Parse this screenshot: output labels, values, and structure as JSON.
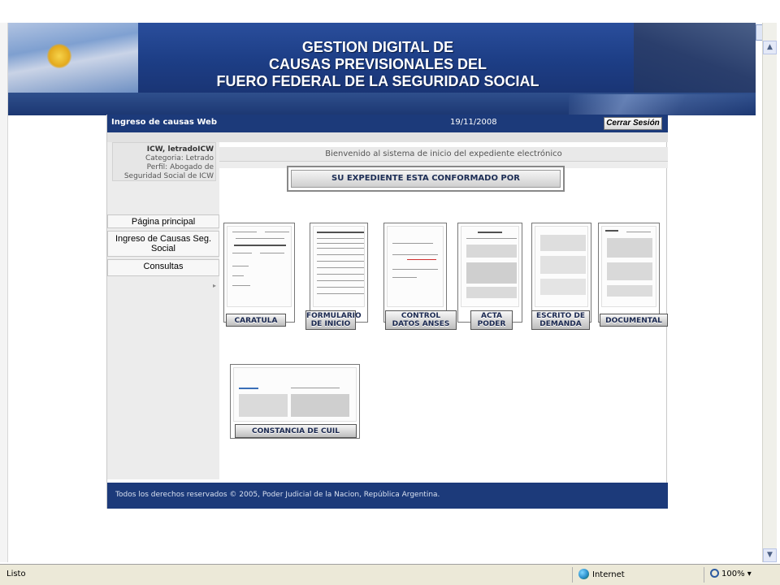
{
  "banner": {
    "title_line1": "GESTION DIGITAL DE",
    "title_line2": "CAUSAS PREVISIONALES DEL",
    "title_line3": "FUERO FEDERAL DE LA SEGURIDAD SOCIAL"
  },
  "topbar": {
    "app_name": "Ingreso de causas Web",
    "date": "19/11/2008",
    "logout_label": "Cerrar Sesión"
  },
  "user": {
    "name": "ICW, letradoICW",
    "category": "Categoria: Letrado",
    "profile": "Perfil: Abogado de",
    "profile_cont": "Seguridad Social de ICW"
  },
  "nav": {
    "home": "Página principal",
    "ingreso_line1": "Ingreso de Causas Seg.",
    "ingreso_line2": "Social",
    "consultas": "Consultas"
  },
  "main": {
    "welcome": "Bienvenido al sistema de inicio del expediente electrónico",
    "expediente_title": "SU EXPEDIENTE ESTA CONFORMADO  POR",
    "documents": [
      {
        "line1": "CARATULA",
        "line2": ""
      },
      {
        "line1": "FORMULARIO",
        "line2": "DE INICIO"
      },
      {
        "line1": "CONTROL",
        "line2": "DATOS ANSES"
      },
      {
        "line1": "ACTA",
        "line2": "PODER"
      },
      {
        "line1": "ESCRITO DE",
        "line2": "DEMANDA"
      },
      {
        "line1": "DOCUMENTAL",
        "line2": ""
      },
      {
        "line1": "CONSTANCIA DE CUIL",
        "line2": ""
      }
    ]
  },
  "footer": {
    "text": "Todos los derechos reservados © 2005, Poder Judicial de la Nacion, República Argentina."
  },
  "statusbar": {
    "status": "Listo",
    "zone": "Internet",
    "zoom": "100%"
  }
}
